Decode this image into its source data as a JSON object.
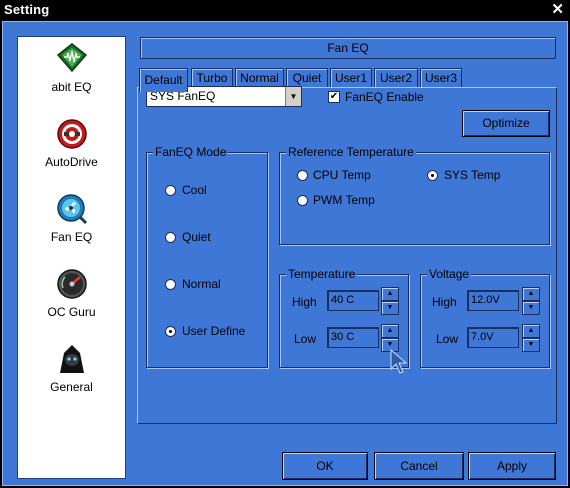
{
  "window": {
    "title": "Setting",
    "close_glyph": "✕"
  },
  "sidebar": {
    "items": [
      {
        "label": "abit EQ",
        "icon": "abit-eq-icon"
      },
      {
        "label": "AutoDrive",
        "icon": "autodrive-icon"
      },
      {
        "label": "Fan EQ",
        "icon": "fan-eq-icon"
      },
      {
        "label": "OC Guru",
        "icon": "oc-guru-icon"
      },
      {
        "label": "General",
        "icon": "general-icon"
      }
    ]
  },
  "header": {
    "title": "Fan EQ"
  },
  "tabs": [
    {
      "label": "Default",
      "active": true
    },
    {
      "label": "Turbo"
    },
    {
      "label": "Normal"
    },
    {
      "label": "Quiet"
    },
    {
      "label": "User1"
    },
    {
      "label": "User2"
    },
    {
      "label": "User3"
    }
  ],
  "fan_select": {
    "value": "SYS FanEQ",
    "arrow": "▼"
  },
  "fan_enable": {
    "label": "FanEQ Enable",
    "checked": true,
    "mark": "✔"
  },
  "optimize_label": "Optimize",
  "mode_group": {
    "legend": "FanEQ Mode",
    "options": [
      {
        "label": "Cool"
      },
      {
        "label": "Quiet"
      },
      {
        "label": "Normal"
      },
      {
        "label": "User Define",
        "selected": true
      }
    ]
  },
  "reference_group": {
    "legend": "Reference Temperature",
    "options": [
      {
        "label": "CPU Temp"
      },
      {
        "label": "SYS Temp",
        "selected": true
      },
      {
        "label": "PWM Temp"
      }
    ]
  },
  "temperature_group": {
    "legend": "Temperature",
    "high_label": "High",
    "high_value": "40 C",
    "low_label": "Low",
    "low_value": "30 C"
  },
  "voltage_group": {
    "legend": "Voltage",
    "high_label": "High",
    "high_value": "12.0V",
    "low_label": "Low",
    "low_value": "7.0V"
  },
  "spin_glyphs": {
    "up": "▲",
    "down": "▼"
  },
  "footer": {
    "ok_label": "OK",
    "cancel_label": "Cancel",
    "apply_label": "Apply"
  },
  "colors": {
    "panel_blue": "#3f77d6",
    "title_bar": "#000000"
  }
}
